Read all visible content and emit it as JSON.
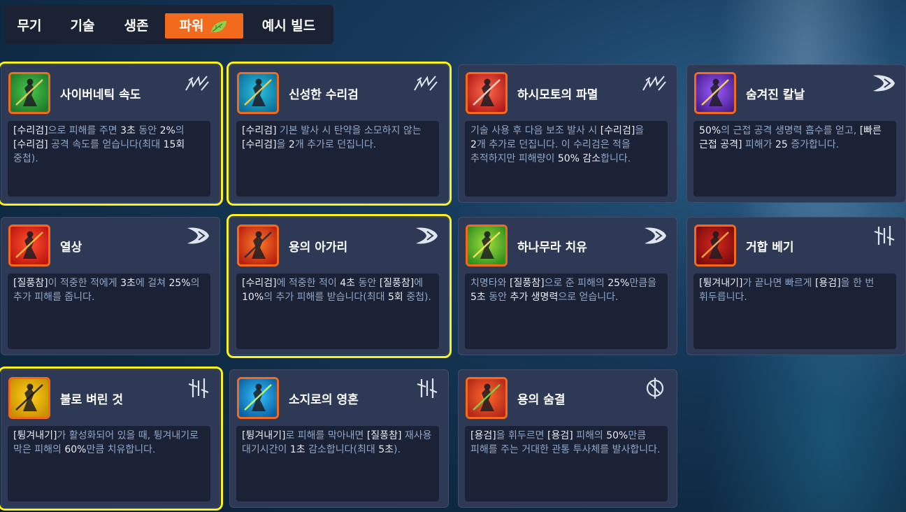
{
  "tabs": [
    {
      "label": "무기",
      "active": false
    },
    {
      "label": "기술",
      "active": false
    },
    {
      "label": "생존",
      "active": false
    },
    {
      "label": "파워",
      "active": true,
      "icon": "leaf-icon"
    },
    {
      "label": "예시 빌드",
      "active": false
    }
  ],
  "colors": {
    "accent": "#f26b1d",
    "highlight": "#fff21a",
    "card_bg": "#2e3a55",
    "desc_bg": "#1b2236",
    "text_muted": "#8ea6c8",
    "text_bright": "#e8edf5"
  },
  "cards": [
    {
      "title": "사이버네틱 속도",
      "highlighted": true,
      "category_icon": "shuriken-category-icon",
      "icon": "cyber-speed-icon",
      "desc": [
        {
          "t": "[수리검]",
          "b": true
        },
        {
          "t": "으로 피해를 주면 ",
          "b": false
        },
        {
          "t": "3초",
          "b": true
        },
        {
          "t": " 동안 ",
          "b": false
        },
        {
          "t": "2%",
          "b": true
        },
        {
          "t": "의 ",
          "b": false
        },
        {
          "t": "[수리검]",
          "b": true
        },
        {
          "t": " 공격 속도를 얻습니다(최대 ",
          "b": false
        },
        {
          "t": "15회",
          "b": true
        },
        {
          "t": " 중첩).",
          "b": false
        }
      ]
    },
    {
      "title": "신성한 수리검",
      "highlighted": true,
      "category_icon": "shuriken-category-icon",
      "icon": "sacred-shuriken-icon",
      "desc": [
        {
          "t": "[수리검]",
          "b": true
        },
        {
          "t": " 기본 발사 시 탄약을 소모하지 않는 ",
          "b": false
        },
        {
          "t": "[수리검]",
          "b": true
        },
        {
          "t": "을 ",
          "b": false
        },
        {
          "t": "2",
          "b": true
        },
        {
          "t": "개 추가로 던집니다.",
          "b": false
        }
      ]
    },
    {
      "title": "하시모토의 파멸",
      "highlighted": false,
      "category_icon": "shuriken-category-icon",
      "icon": "hashimoto-icon",
      "desc": [
        {
          "t": "기술 사용 후 다음 보조 발사 시 ",
          "b": false
        },
        {
          "t": "[수리검]",
          "b": true
        },
        {
          "t": "을 ",
          "b": false
        },
        {
          "t": "2",
          "b": true
        },
        {
          "t": "개 추가로 던집니다. 이 수리검은 적을 추적하지만 피해량이 ",
          "b": false
        },
        {
          "t": "50% 감소",
          "b": true
        },
        {
          "t": "합니다.",
          "b": false
        }
      ]
    },
    {
      "title": "숨겨진 칼날",
      "highlighted": false,
      "category_icon": "swift-strike-category-icon",
      "icon": "hidden-blade-icon",
      "desc": [
        {
          "t": "50%",
          "b": true
        },
        {
          "t": "의 근접 공격 생명력 흡수를 얻고, ",
          "b": false
        },
        {
          "t": "[빠른 근접 공격]",
          "b": true
        },
        {
          "t": " 피해가 ",
          "b": false
        },
        {
          "t": "25",
          "b": true
        },
        {
          "t": " 증가합니다.",
          "b": false
        }
      ]
    },
    {
      "title": "열상",
      "highlighted": false,
      "category_icon": "swift-strike-category-icon",
      "icon": "laceration-icon",
      "desc": [
        {
          "t": "[질풍참]",
          "b": true
        },
        {
          "t": "이 적중한 적에게 ",
          "b": false
        },
        {
          "t": "3초",
          "b": true
        },
        {
          "t": "에 걸쳐 ",
          "b": false
        },
        {
          "t": "25%",
          "b": true
        },
        {
          "t": "의 추가 피해를 줍니다.",
          "b": false
        }
      ]
    },
    {
      "title": "용의 아가리",
      "highlighted": true,
      "category_icon": "swift-strike-category-icon",
      "icon": "dragon-maw-icon",
      "desc": [
        {
          "t": "[수리검]",
          "b": true
        },
        {
          "t": "에 적중한 적이 ",
          "b": false
        },
        {
          "t": "4초",
          "b": true
        },
        {
          "t": " 동안 ",
          "b": false
        },
        {
          "t": "[질풍참]",
          "b": true
        },
        {
          "t": "에 ",
          "b": false
        },
        {
          "t": "10%",
          "b": true
        },
        {
          "t": "의 추가 피해를 받습니다(최대 ",
          "b": false
        },
        {
          "t": "5회",
          "b": true
        },
        {
          "t": " 중첩).",
          "b": false
        }
      ]
    },
    {
      "title": "하나무라 치유",
      "highlighted": false,
      "category_icon": "swift-strike-category-icon",
      "icon": "hanamura-healing-icon",
      "desc": [
        {
          "t": "치명타와 ",
          "b": false
        },
        {
          "t": "[질풍참]",
          "b": true
        },
        {
          "t": "으로 준 피해의 ",
          "b": false
        },
        {
          "t": "25%",
          "b": true
        },
        {
          "t": "만큼을 ",
          "b": false
        },
        {
          "t": "5초",
          "b": true
        },
        {
          "t": " 동안 ",
          "b": false
        },
        {
          "t": "추가 생명력",
          "b": true
        },
        {
          "t": "으로 얻습니다.",
          "b": false
        }
      ]
    },
    {
      "title": "거합 베기",
      "highlighted": false,
      "category_icon": "deflect-category-icon",
      "icon": "iai-slash-icon",
      "desc": [
        {
          "t": "[튕겨내기]",
          "b": true
        },
        {
          "t": "가 끝나면 빠르게 ",
          "b": false
        },
        {
          "t": "[용검]",
          "b": true
        },
        {
          "t": "을 한 번 휘두릅니다.",
          "b": false
        }
      ]
    },
    {
      "title": "불로 벼린 것",
      "highlighted": true,
      "category_icon": "deflect-category-icon",
      "icon": "forged-in-fire-icon",
      "desc": [
        {
          "t": "[튕겨내기]",
          "b": true
        },
        {
          "t": "가 활성화되어 있을 때, 튕겨내기로 막은 피해의 ",
          "b": false
        },
        {
          "t": "60%",
          "b": true
        },
        {
          "t": "만큼 치유합니다.",
          "b": false
        }
      ]
    },
    {
      "title": "소지로의 영혼",
      "highlighted": false,
      "category_icon": "deflect-category-icon",
      "icon": "sojiro-spirit-icon",
      "desc": [
        {
          "t": "[튕겨내기]",
          "b": true
        },
        {
          "t": "로 피해를 막아내면 ",
          "b": false
        },
        {
          "t": "[질풍참]",
          "b": true
        },
        {
          "t": " 재사용 대기시간이 ",
          "b": false
        },
        {
          "t": "1초",
          "b": true
        },
        {
          "t": " 감소합니다(최대 ",
          "b": false
        },
        {
          "t": "5초",
          "b": true
        },
        {
          "t": ").",
          "b": false
        }
      ]
    },
    {
      "title": "용의 숨결",
      "highlighted": false,
      "category_icon": "dragonblade-category-icon",
      "icon": "dragon-breath-icon",
      "desc": [
        {
          "t": "[용검]",
          "b": true
        },
        {
          "t": "을 휘두르면 ",
          "b": false
        },
        {
          "t": "[용검]",
          "b": true
        },
        {
          "t": " 피해의 ",
          "b": false
        },
        {
          "t": "50%",
          "b": true
        },
        {
          "t": "만큼 피해를 주는 거대한 관통 투사체를 발사합니다.",
          "b": false
        }
      ]
    }
  ]
}
